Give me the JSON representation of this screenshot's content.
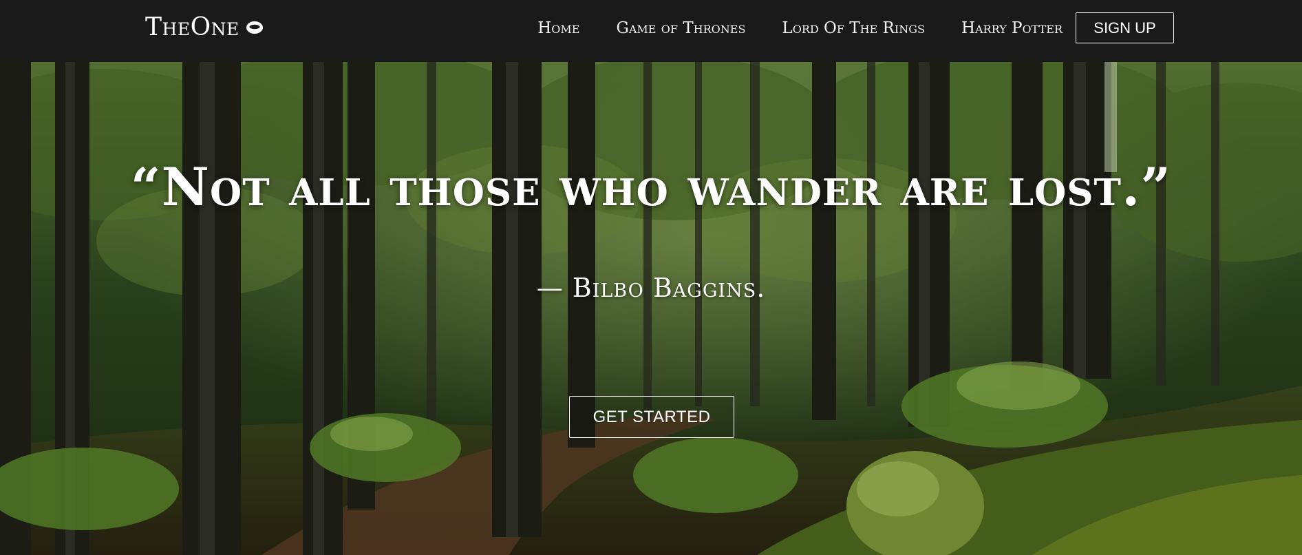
{
  "navbar": {
    "brand": "TheOne",
    "brand_icon": "ring-icon",
    "links": [
      {
        "label": "Home"
      },
      {
        "label": "Game of Thrones"
      },
      {
        "label": "Lord Of The Rings"
      },
      {
        "label": "Harry Potter"
      }
    ],
    "signup_label": "SIGN UP"
  },
  "hero": {
    "quote": "“Not all those who wander are lost.”",
    "author": "— Bilbo Baggins.",
    "cta_label": "GET STARTED",
    "background": "forest-photo"
  },
  "colors": {
    "navbar_bg": "#1b1a1b",
    "text": "#ffffff"
  }
}
